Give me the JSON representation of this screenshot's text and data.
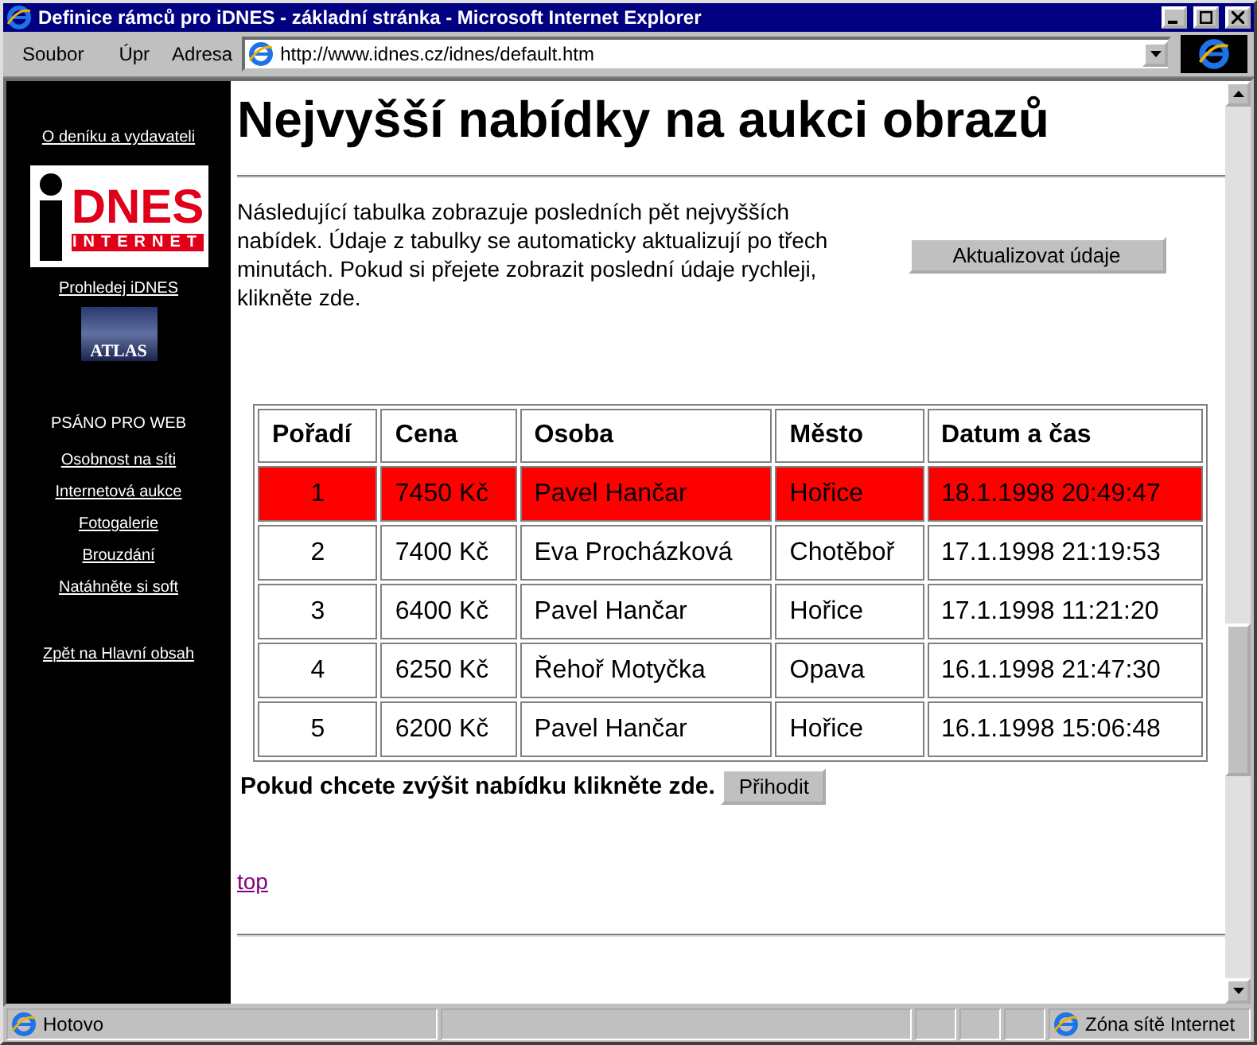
{
  "window": {
    "title": "Definice rámců pro iDNES - základní stránka - Microsoft Internet Explorer"
  },
  "toolbar": {
    "menus": [
      "Soubor",
      "Úpr"
    ],
    "address_label": "Adresa",
    "address": "http://www.idnes.cz/idnes/default.htm"
  },
  "sidebar": {
    "top_link": "O deníku a vydavateli",
    "logo": {
      "main": "DNES",
      "sub": "INTERNET"
    },
    "search_link": "Prohledej iDNES",
    "atlas": "ATLAS",
    "section": "PSÁNO PRO WEB",
    "links": [
      "Osobnost na síti",
      "Internetová aukce",
      "Fotogalerie",
      "Brouzdání",
      "Natáhněte si soft"
    ],
    "back_link": "Zpět na Hlavní obsah"
  },
  "page": {
    "heading": "Nejvyšší nabídky na aukci obrazů",
    "intro": "Následující tabulka zobrazuje posledních pět nejvyšších nabídek. Údaje z tabulky se automaticky aktualizují po třech minutách. Pokud si přejete zobrazit poslední údaje rychleji, klikněte zde.",
    "refresh_button": "Aktualizovat údaje",
    "table": {
      "columns": [
        "Pořadí",
        "Cena",
        "Osoba",
        "Město",
        "Datum a čas"
      ],
      "rows": [
        {
          "cells": [
            "1",
            "7450 Kč",
            "Pavel Hančar",
            "Hořice",
            "18.1.1998 20:49:47"
          ],
          "selected": true
        },
        {
          "cells": [
            "2",
            "7400 Kč",
            "Eva Procházková",
            "Chotěboř",
            "17.1.1998 21:19:53"
          ],
          "selected": false
        },
        {
          "cells": [
            "3",
            "6400 Kč",
            "Pavel Hančar",
            "Hořice",
            "17.1.1998 11:21:20"
          ],
          "selected": false
        },
        {
          "cells": [
            "4",
            "6250 Kč",
            "Řehoř Motyčka",
            "Opava",
            "16.1.1998 21:47:30"
          ],
          "selected": false
        },
        {
          "cells": [
            "5",
            "6200 Kč",
            "Pavel Hančar",
            "Hořice",
            "16.1.1998 15:06:48"
          ],
          "selected": false
        }
      ]
    },
    "bid_text": "Pokud chcete zvýšit nabídku klikněte zde.",
    "bid_button": "Přihodit",
    "top_link": "top"
  },
  "status_bar": {
    "status": "Hotovo",
    "zone": "Zóna sítě Internet"
  }
}
